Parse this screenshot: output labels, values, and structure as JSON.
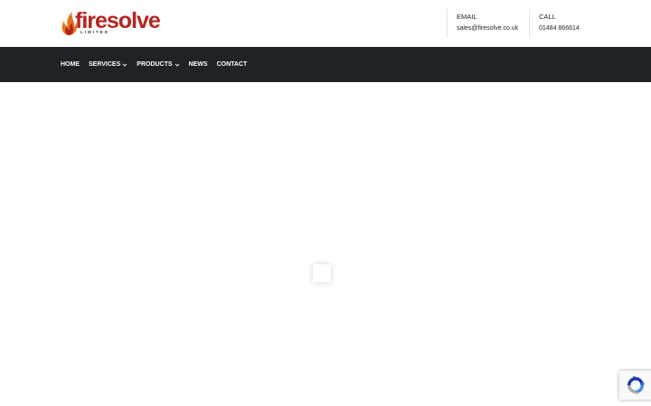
{
  "brand": {
    "name": "firesolve",
    "subtitle": "LIMITED",
    "brand_color": "#b5251f",
    "flame_colors": [
      "#e8731c",
      "#b5251f"
    ]
  },
  "contact": {
    "email": {
      "label": "EMAIL",
      "value": "sales@firesolve.co.uk"
    },
    "call": {
      "label": "CALL",
      "value": "01484 866614"
    }
  },
  "nav": {
    "background": "#1f2226",
    "items": [
      {
        "label": "HOME",
        "has_dropdown": false
      },
      {
        "label": "SERVICES",
        "has_dropdown": true,
        "icon": "chevron-down-icon"
      },
      {
        "label": "PRODUCTS",
        "has_dropdown": true,
        "icon": "chevron-down-icon"
      },
      {
        "label": "NEWS",
        "has_dropdown": false
      },
      {
        "label": "CONTACT",
        "has_dropdown": false
      }
    ]
  },
  "main": {
    "loader_icon": "loading-spinner-icon"
  },
  "recaptcha": {
    "icon": "recaptcha-icon"
  }
}
